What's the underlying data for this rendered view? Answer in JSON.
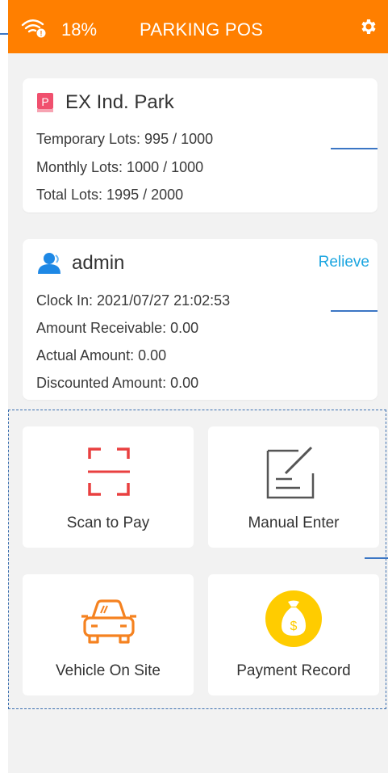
{
  "status": {
    "battery": "18%"
  },
  "header": {
    "title": "PARKING POS"
  },
  "park": {
    "name": "EX Ind. Park",
    "temporary": "Temporary Lots: 995 / 1000",
    "monthly": "Monthly Lots: 1000 / 1000",
    "total": "Total Lots: 1995 / 2000"
  },
  "user": {
    "name": "admin",
    "relieve": "Relieve",
    "clock_in": "Clock In: 2021/07/27 21:02:53",
    "receivable": "Amount Receivable: 0.00",
    "actual": "Actual Amount: 0.00",
    "discounted": "Discounted Amount: 0.00"
  },
  "actions": {
    "scan": "Scan to Pay",
    "manual": "Manual Enter",
    "vehicle": "Vehicle On Site",
    "payment": "Payment Record"
  },
  "colors": {
    "brand": "#ff7f00",
    "link": "#1aa5e0",
    "scan": "#e94040",
    "coin": "#ffcc00",
    "annotation": "#3b76c4"
  },
  "icons": [
    "wifi-icon",
    "gear-icon",
    "parking-icon",
    "user-icon",
    "scan-icon",
    "edit-icon",
    "car-icon",
    "money-bag-icon"
  ]
}
